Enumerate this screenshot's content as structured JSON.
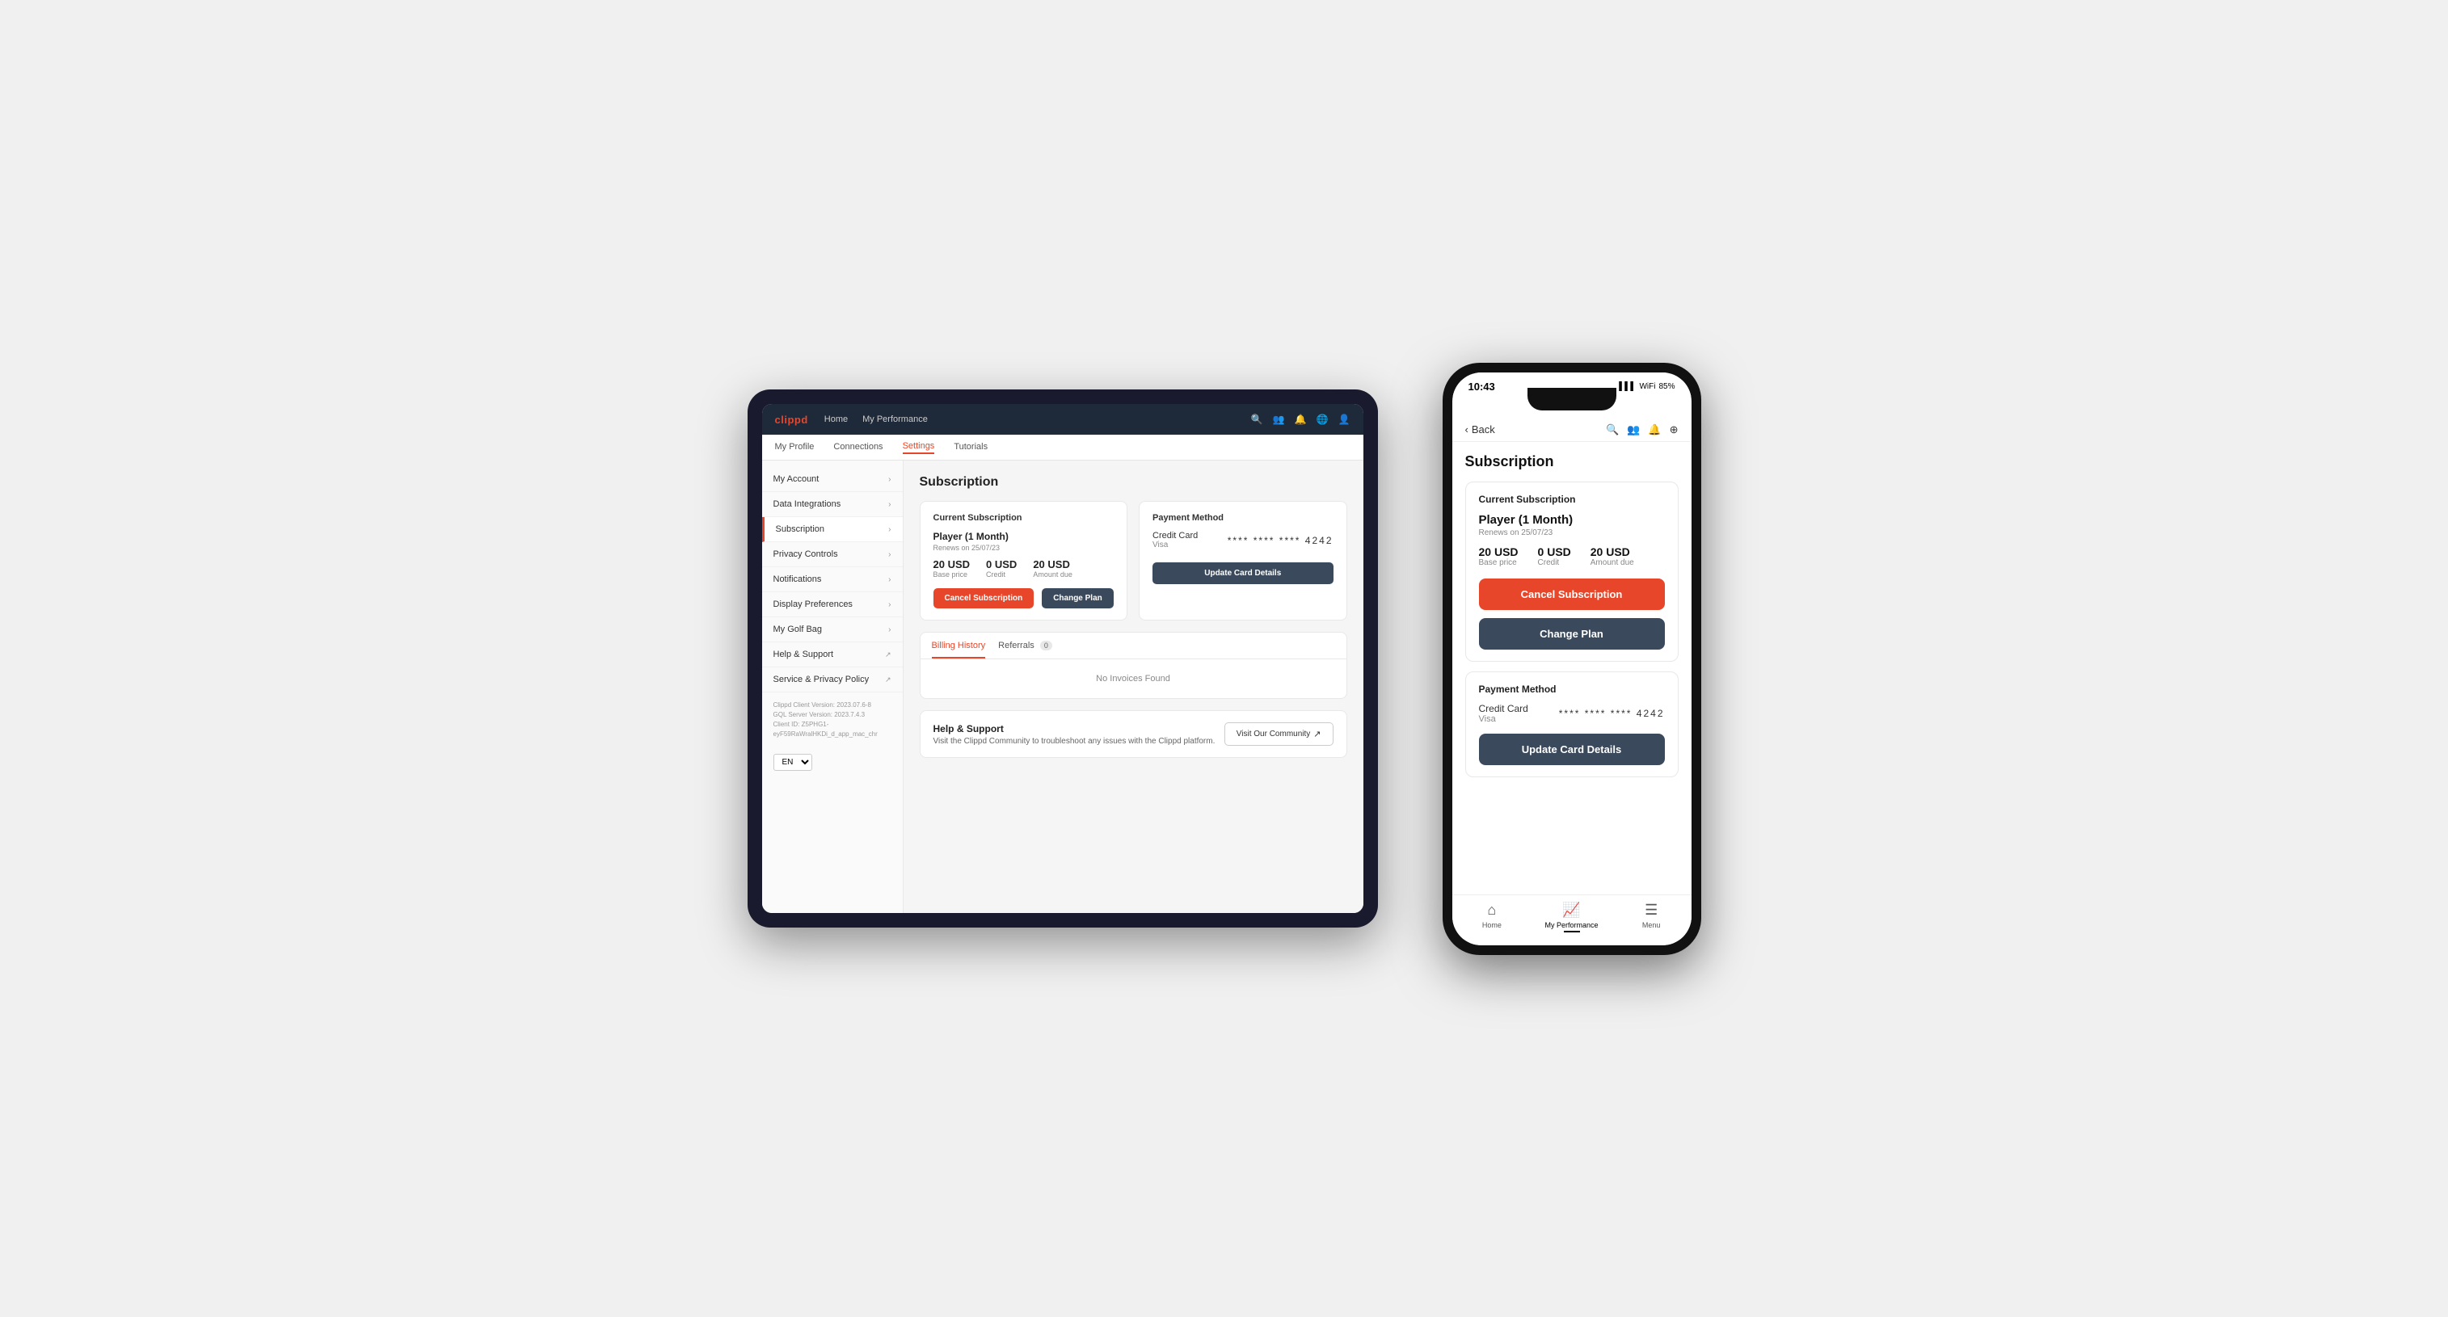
{
  "tablet": {
    "logo": "clippd",
    "nav": {
      "links": [
        "Home",
        "My Performance"
      ],
      "icons": [
        "search",
        "people",
        "bell",
        "globe",
        "account"
      ]
    },
    "subnav": {
      "items": [
        "My Profile",
        "Connections",
        "Settings",
        "Tutorials"
      ],
      "active": "Settings"
    },
    "sidebar": {
      "items": [
        {
          "label": "My Account",
          "active": false
        },
        {
          "label": "Data Integrations",
          "active": false
        },
        {
          "label": "Subscription",
          "active": true
        },
        {
          "label": "Privacy Controls",
          "active": false
        },
        {
          "label": "Notifications",
          "active": false
        },
        {
          "label": "Display Preferences",
          "active": false
        },
        {
          "label": "My Golf Bag",
          "active": false
        },
        {
          "label": "Help & Support",
          "active": false,
          "external": true
        },
        {
          "label": "Service & Privacy Policy",
          "active": false,
          "external": true
        }
      ],
      "footer": {
        "version": "Clippd Client Version: 2023.07.6-8",
        "gql_version": "GQL Server Version: 2023.7.4.3",
        "client_id": "Client ID: Z5PHG1-eyF59RaWralHKDi_d_app_mac_chr"
      },
      "lang": "EN"
    },
    "main": {
      "page_title": "Subscription",
      "current_subscription": {
        "section_title": "Current Subscription",
        "plan_name": "Player (1 Month)",
        "renews": "Renews on 25/07/23",
        "base_price": "20 USD",
        "base_price_label": "Base price",
        "credit": "0 USD",
        "credit_label": "Credit",
        "amount_due": "20 USD",
        "amount_due_label": "Amount due",
        "btn_cancel": "Cancel Subscription",
        "btn_change": "Change Plan"
      },
      "payment_method": {
        "section_title": "Payment Method",
        "type": "Credit Card",
        "brand": "Visa",
        "masked": "**** **** **** 4242",
        "btn_update": "Update Card Details"
      },
      "billing": {
        "tabs": [
          {
            "label": "Billing History",
            "active": true,
            "badge": null
          },
          {
            "label": "Referrals",
            "active": false,
            "badge": "0"
          }
        ],
        "empty_message": "No Invoices Found"
      },
      "help": {
        "section_title": "Help & Support",
        "description": "Visit the Clippd Community to troubleshoot any issues with the Clippd platform.",
        "btn_community": "Visit Our Community"
      }
    }
  },
  "phone": {
    "status_bar": {
      "time": "10:43",
      "signal": "▋▋▋",
      "wifi": "WiFi",
      "battery": "85"
    },
    "topbar": {
      "back_label": "Back",
      "icons": [
        "search",
        "people",
        "bell",
        "plus"
      ]
    },
    "page_title": "Subscription",
    "current_subscription": {
      "section_title": "Current Subscription",
      "plan_name": "Player (1 Month)",
      "renews": "Renews on 25/07/23",
      "base_price": "20 USD",
      "base_price_label": "Base price",
      "credit": "0 USD",
      "credit_label": "Credit",
      "amount_due": "20 USD",
      "amount_due_label": "Amount due",
      "btn_cancel": "Cancel Subscription",
      "btn_change": "Change Plan"
    },
    "payment_method": {
      "section_title": "Payment Method",
      "type": "Credit Card",
      "brand": "Visa",
      "masked": "**** **** **** 4242",
      "btn_update": "Update Card Details"
    },
    "bottom_nav": {
      "items": [
        {
          "label": "Home",
          "active": false
        },
        {
          "label": "My Performance",
          "active": true
        },
        {
          "label": "Menu",
          "active": false
        }
      ]
    }
  }
}
